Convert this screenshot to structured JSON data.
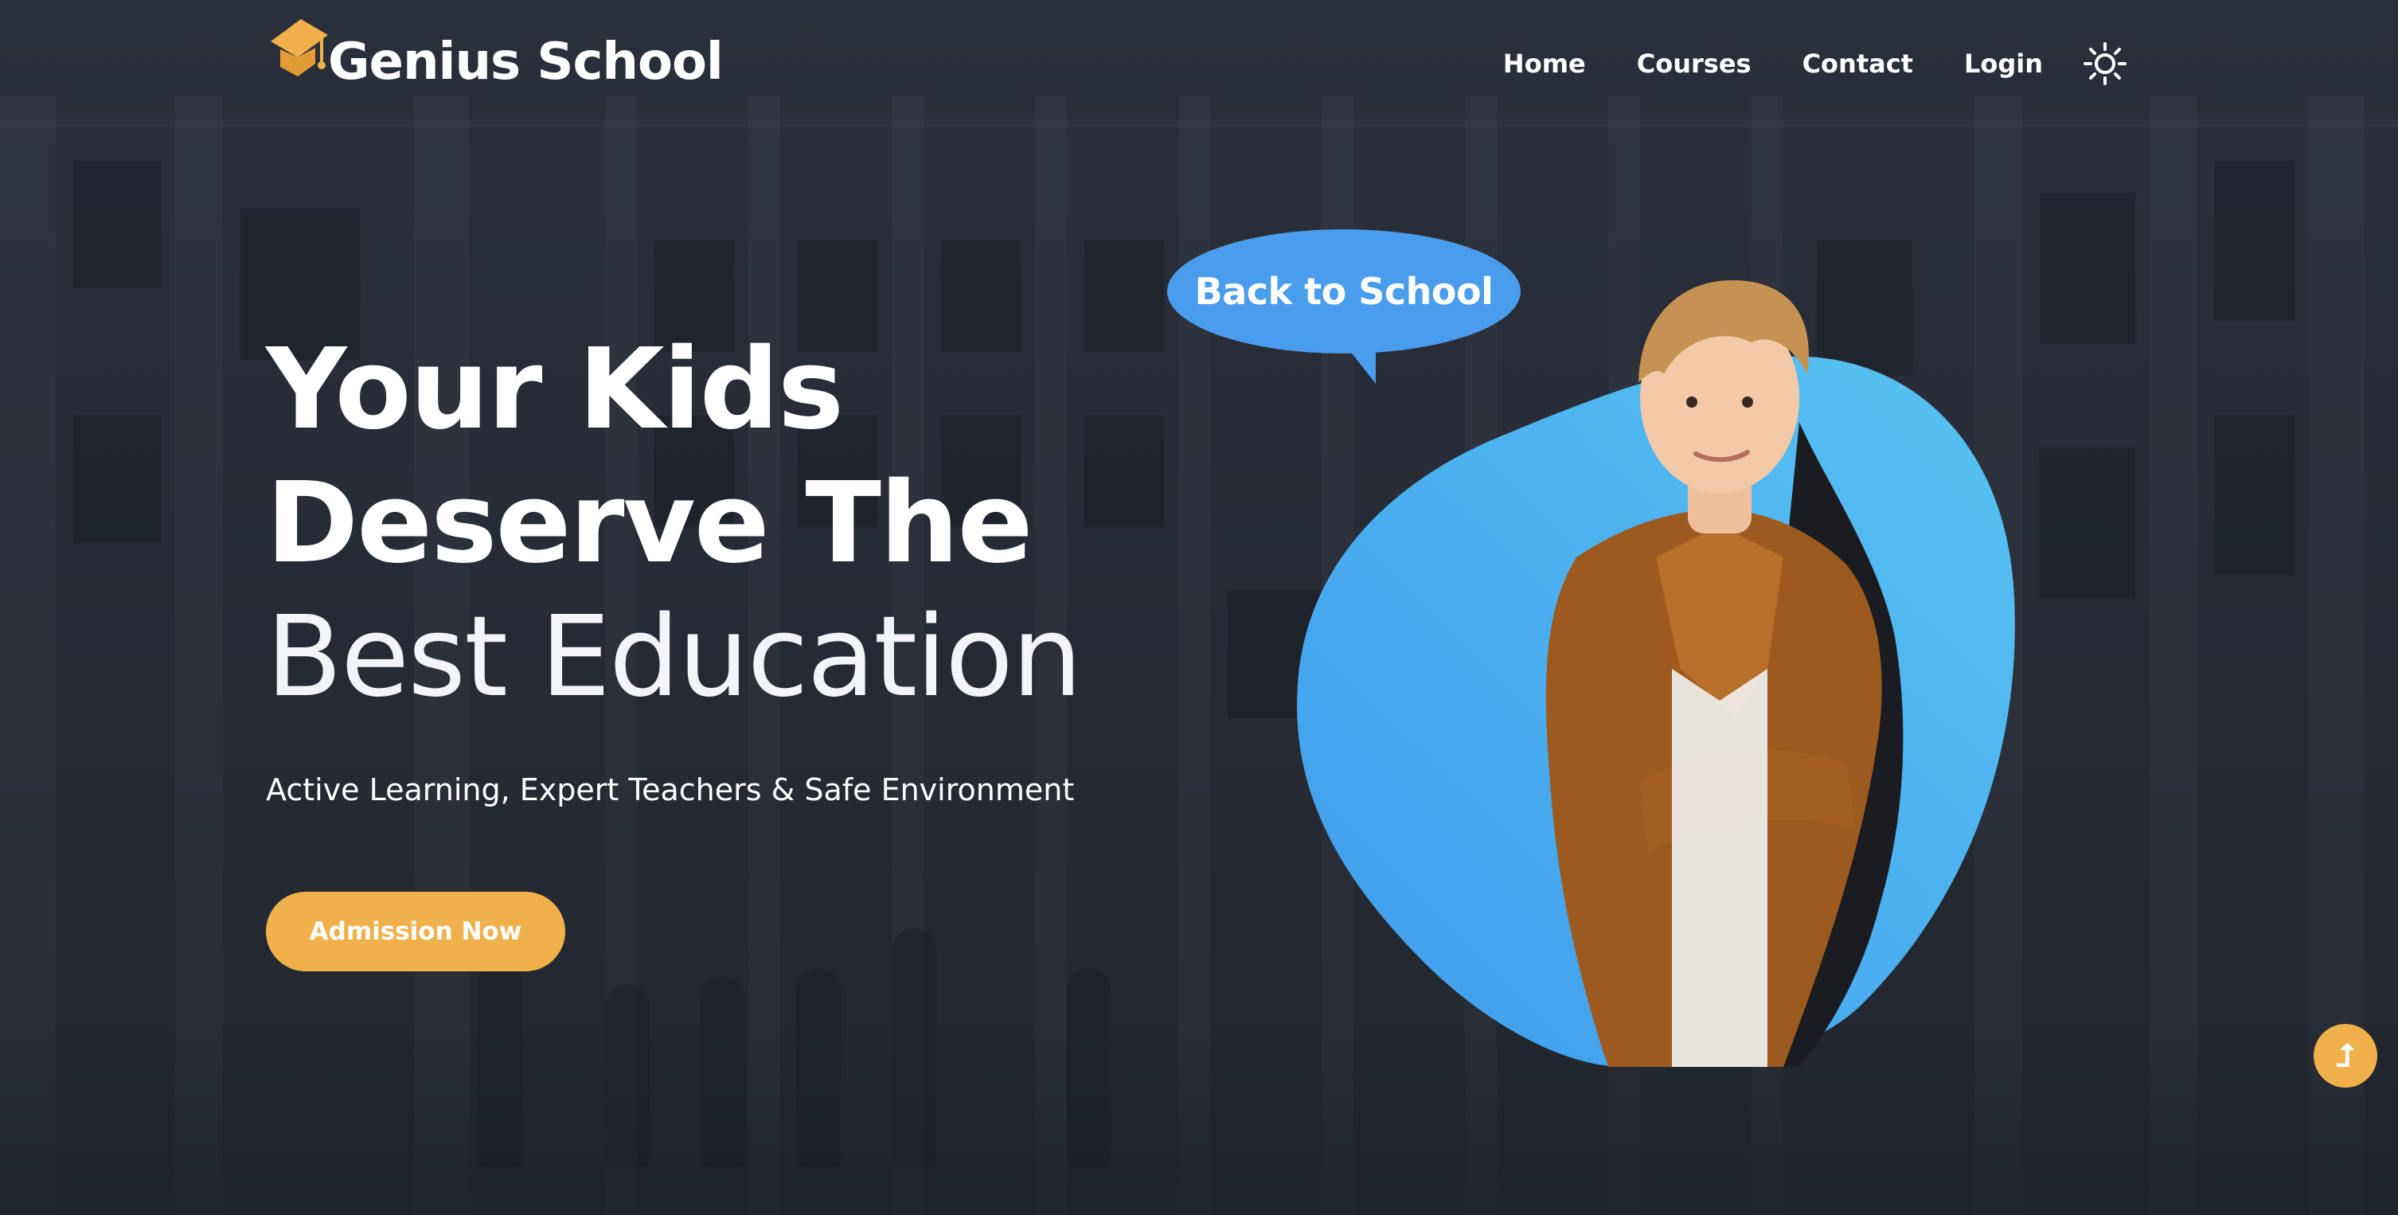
{
  "brand": {
    "name": "Genius School",
    "logo_icon": "graduation-cap-icon",
    "accent_color": "#f0b04b"
  },
  "nav": {
    "items": [
      {
        "label": "Home"
      },
      {
        "label": "Courses"
      },
      {
        "label": "Contact"
      },
      {
        "label": "Login"
      }
    ],
    "theme_toggle_icon": "sun-icon"
  },
  "hero": {
    "headline_line1": "Your Kids",
    "headline_line2": "Deserve The",
    "headline_line3": "Best Education",
    "subtitle": "Active Learning, Expert Teachers & Safe Environment",
    "cta_label": "Admission Now",
    "bubble_text": "Back to School",
    "blob_color": "#4aa9ef"
  },
  "scroll_top": {
    "icon": "arrow-up-icon",
    "glyph": "⮥"
  }
}
